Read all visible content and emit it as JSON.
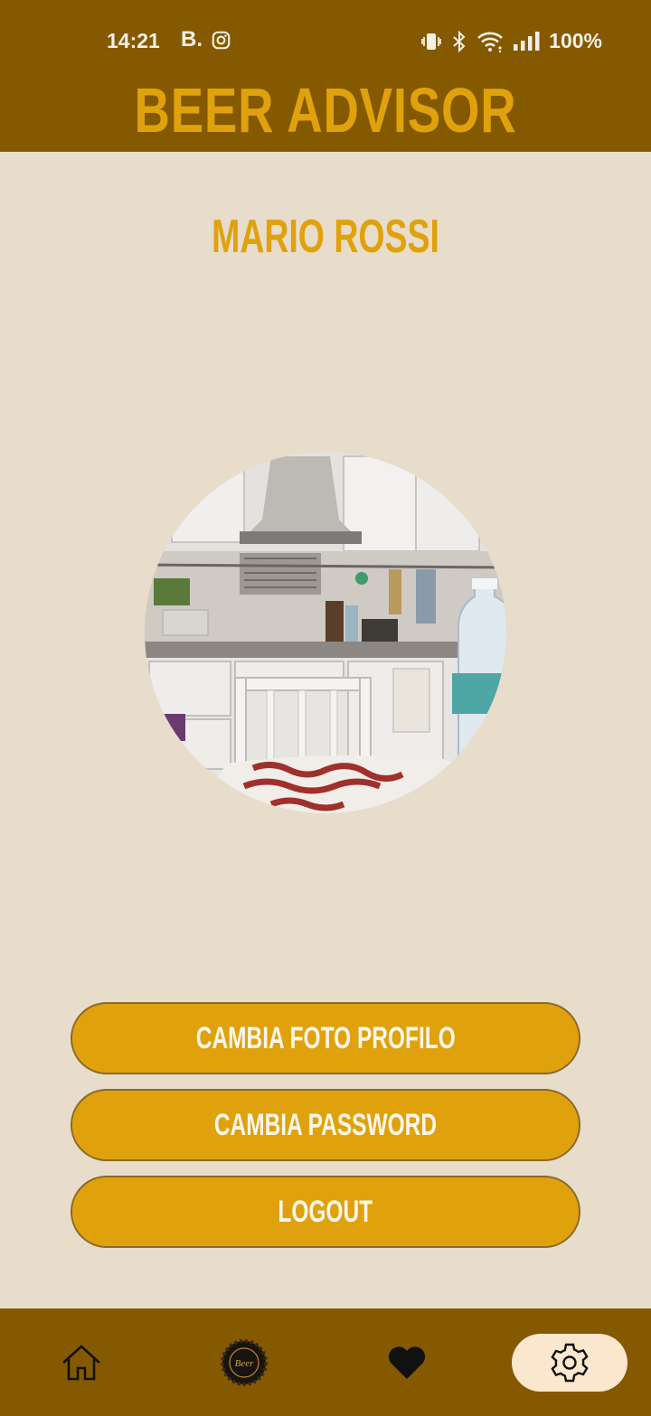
{
  "status_bar": {
    "time": "14:21",
    "notification_letter": "B.",
    "battery": "100%"
  },
  "header": {
    "title": "BEER ADVISOR"
  },
  "profile": {
    "name": "MARIO ROSSI",
    "photo": "profile-photo-kitchen"
  },
  "actions": {
    "change_photo": "CAMBIA FOTO PROFILO",
    "change_password": "CAMBIA PASSWORD",
    "logout": "LOGOUT"
  },
  "bottom_nav": {
    "items": [
      {
        "icon": "home-icon"
      },
      {
        "icon": "beer-cap-icon",
        "logo_text": "Beer"
      },
      {
        "icon": "heart-icon"
      },
      {
        "icon": "gear-icon",
        "active": true
      }
    ]
  },
  "colors": {
    "header_bg": "#845900",
    "accent": "#e0a20c",
    "background": "#e8dccb",
    "active_nav": "#fbe7cd"
  }
}
